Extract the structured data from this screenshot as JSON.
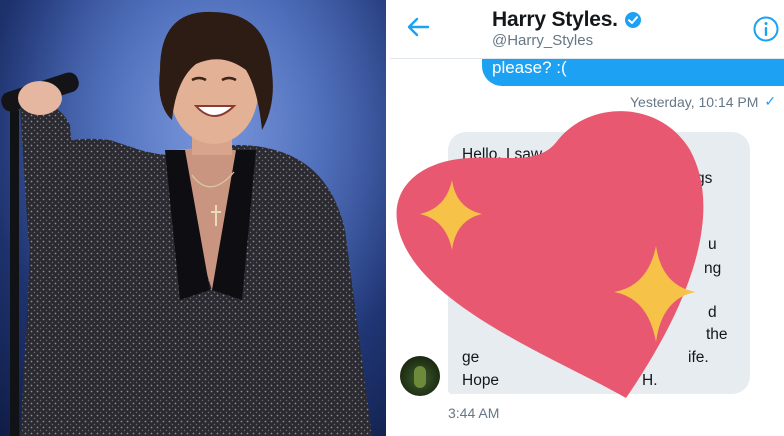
{
  "chat": {
    "title": "Harry Styles.",
    "handle": "@Harry_Styles",
    "sent_message_tail": "please? :(",
    "sent_timestamp": "Yesterday, 10:14 PM",
    "read_check": "✓",
    "received_lines": [
      "Hello, I saw",
      "gs",
      "u",
      "ng",
      "d",
      "the",
      "ge",
      "ife.",
      "Hope",
      "H."
    ],
    "received_timestamp": "3:44 AM"
  },
  "colors": {
    "accent_blue": "#1da1f2",
    "heart": "#e85870",
    "stars": "#f6c247",
    "bubble_gray": "#e6ecf0"
  },
  "icons": [
    "back-arrow-icon",
    "verified-badge-icon",
    "info-icon",
    "heart-emoji-icon",
    "sparkle-star-icon"
  ]
}
